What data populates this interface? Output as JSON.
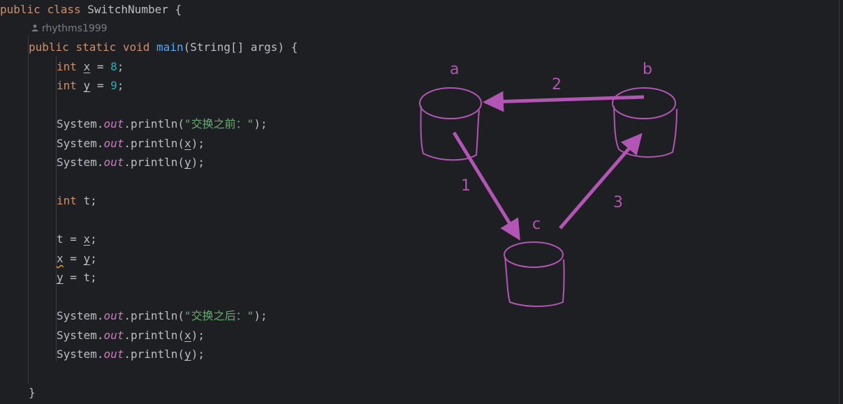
{
  "code": {
    "class_decl": {
      "kw1": "public",
      "kw2": "class",
      "name": "SwitchNumber",
      "brace": "{"
    },
    "author": "rhythms1999",
    "main_decl": {
      "kw1": "public",
      "kw2": "static",
      "kw3": "void",
      "fn": "main",
      "params": "(String[] args) {"
    },
    "x_decl": {
      "type": "int",
      "name": "x",
      "eq": " = ",
      "val": "8",
      "end": ";"
    },
    "y_decl": {
      "type": "int",
      "name": "y",
      "eq": " = ",
      "val": "9",
      "end": ";"
    },
    "print1": {
      "obj": "System.",
      "field": "out",
      "call": ".println(",
      "arg": "\"交换之前：\"",
      "end": ");"
    },
    "print2": {
      "obj": "System.",
      "field": "out",
      "call": ".println(",
      "arg": "x",
      "end": ");"
    },
    "print3": {
      "obj": "System.",
      "field": "out",
      "call": ".println(",
      "arg": "y",
      "end": ");"
    },
    "t_decl": {
      "type": "int",
      "rest": " t;"
    },
    "assign1": {
      "lhs": "t = ",
      "rhs": "x",
      "end": ";"
    },
    "assign2": {
      "lhs": "x",
      "mid": " = ",
      "rhs": "y",
      "end": ";"
    },
    "assign3": {
      "lhs": "y",
      "rest": " = t;"
    },
    "print4": {
      "obj": "System.",
      "field": "out",
      "call": ".println(",
      "arg": "\"交换之后：\"",
      "end": ");"
    },
    "print5": {
      "obj": "System.",
      "field": "out",
      "call": ".println(",
      "arg": "x",
      "end": ");"
    },
    "print6": {
      "obj": "System.",
      "field": "out",
      "call": ".println(",
      "arg": "y",
      "end": ");"
    },
    "close_brace": "}"
  },
  "diagram": {
    "color": "#b355b5",
    "nodes": {
      "a": "a",
      "b": "b",
      "c": "c"
    },
    "steps": {
      "s1": "1",
      "s2": "2",
      "s3": "3"
    }
  },
  "colors": {
    "background": "#1e1f22",
    "keyword": "#cf8e6d",
    "function": "#56a8f5",
    "number": "#2aacb8",
    "string": "#6aab73",
    "field": "#c77dbb",
    "text": "#bcbec4"
  }
}
